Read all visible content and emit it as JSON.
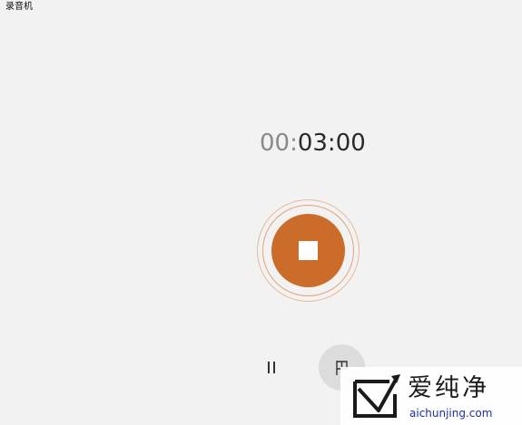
{
  "window": {
    "title": "录音机"
  },
  "timer": {
    "dim_part": "00:",
    "bright_part": "03:00"
  },
  "controls": {
    "stop": {
      "icon": "stop-icon",
      "color": "#cc6c2a"
    },
    "pause": {
      "icon": "pause-icon"
    },
    "marker": {
      "icon": "flag-icon"
    }
  },
  "watermark": {
    "brand_text": "爱纯净",
    "url": "aichunjing.com"
  }
}
